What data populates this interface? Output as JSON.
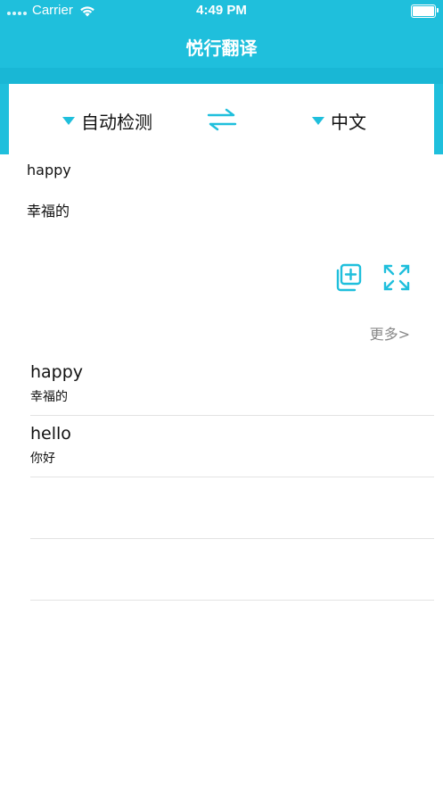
{
  "status_bar": {
    "carrier": "Carrier",
    "time": "4:49 PM"
  },
  "nav": {
    "title": "悦行翻译"
  },
  "lang": {
    "source": "自动检测",
    "target": "中文",
    "swap_icon": "swap-arrows-icon"
  },
  "input": {
    "source_text": "happy",
    "result_text": "幸福的"
  },
  "actions": {
    "copy_icon": "add-to-collection-icon",
    "fullscreen_icon": "expand-icon"
  },
  "more_label": "更多>",
  "history": [
    {
      "word": "happy",
      "translation": "幸福的"
    },
    {
      "word": "hello",
      "translation": "你好"
    },
    {
      "word": "",
      "translation": ""
    },
    {
      "word": "",
      "translation": ""
    }
  ],
  "colors": {
    "accent": "#1fbfdc",
    "muted": "#888888"
  }
}
